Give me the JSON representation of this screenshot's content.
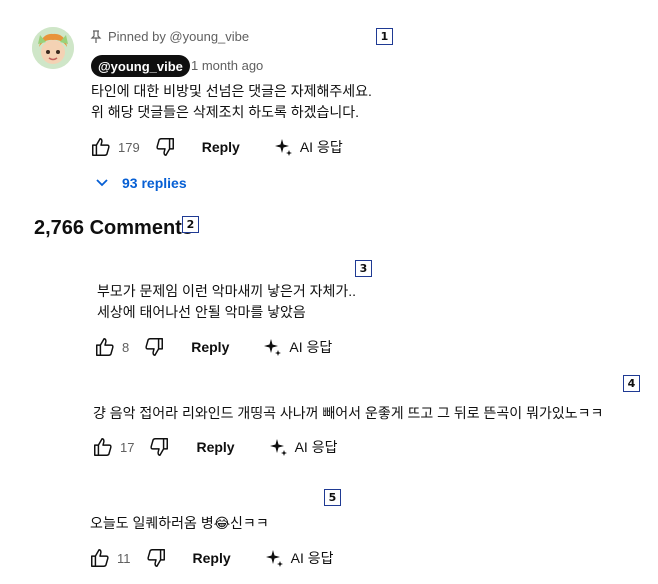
{
  "pinned_comment": {
    "pinned_label": "Pinned by @young_vibe",
    "author": "@young_vibe",
    "time": "1 month ago",
    "lines": [
      "타인에 대한 비방및 선넘은 댓글은 자제해주세요.",
      "위 해당 댓글들은 삭제조치 하도록 하겠습니다."
    ],
    "likes": "179",
    "reply_label": "Reply",
    "ai_label": "AI 응답",
    "replies_label": "93 replies"
  },
  "comments_count": "2,766 Comments",
  "comments": [
    {
      "lines": [
        "부모가 문제임 이런 악마새끼 낳은거 자체가..",
        "세상에 태어나선 안될 악마를 낳았음"
      ],
      "likes": "8",
      "reply_label": "Reply",
      "ai_label": "AI 응답"
    },
    {
      "lines": [
        "걍 음악 접어라 리와인드 개띵곡 사나꺼 빼어서 운좋게 뜨고 그 뒤로 뜬곡이 뭐가있노ㅋㅋ"
      ],
      "likes": "17",
      "reply_label": "Reply",
      "ai_label": "AI 응답"
    },
    {
      "lines": [
        "오늘도 일퀘하러옴 병😂신ㅋㅋ"
      ],
      "likes": "11",
      "reply_label": "Reply",
      "ai_label": "AI 응답"
    }
  ],
  "markers": [
    "1",
    "2",
    "3",
    "4",
    "5"
  ],
  "colors": {
    "link": "#065fd4",
    "handle_bg": "#0f0f0f",
    "meta": "#606060",
    "marker_border": "#1f3a93"
  }
}
